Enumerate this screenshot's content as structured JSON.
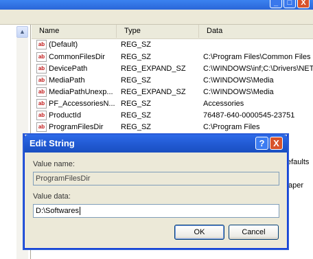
{
  "list": {
    "columns": [
      "Name",
      "Type",
      "Data"
    ],
    "rows": [
      {
        "name": "(Default)",
        "type": "REG_SZ",
        "data": ""
      },
      {
        "name": "CommonFilesDir",
        "type": "REG_SZ",
        "data": "C:\\Program Files\\Common Files"
      },
      {
        "name": "DevicePath",
        "type": "REG_EXPAND_SZ",
        "data": "C:\\WINDOWS\\inf;C:\\Drivers\\NET"
      },
      {
        "name": "MediaPath",
        "type": "REG_SZ",
        "data": "C:\\WINDOWS\\Media"
      },
      {
        "name": "MediaPathUnexp...",
        "type": "REG_EXPAND_SZ",
        "data": "C:\\WINDOWS\\Media"
      },
      {
        "name": "PF_AccessoriesN...",
        "type": "REG_SZ",
        "data": "Accessories"
      },
      {
        "name": "ProductId",
        "type": "REG_SZ",
        "data": "76487-640-0000545-23751"
      },
      {
        "name": "ProgramFilesDir",
        "type": "REG_SZ",
        "data": "C:\\Program Files"
      }
    ],
    "peek_right": [
      "efaults",
      "aper"
    ]
  },
  "icons": {
    "string_value": "ab"
  },
  "dialog": {
    "title": "Edit String",
    "help_glyph": "?",
    "close_glyph": "X",
    "value_name_label": "Value name:",
    "value_name": "ProgramFilesDir",
    "value_data_label": "Value data:",
    "value_data": "D:\\Softwares",
    "ok_label": "OK",
    "cancel_label": "Cancel"
  },
  "window_buttons": {
    "minimize": "_",
    "maximize": "□",
    "close": "X"
  }
}
